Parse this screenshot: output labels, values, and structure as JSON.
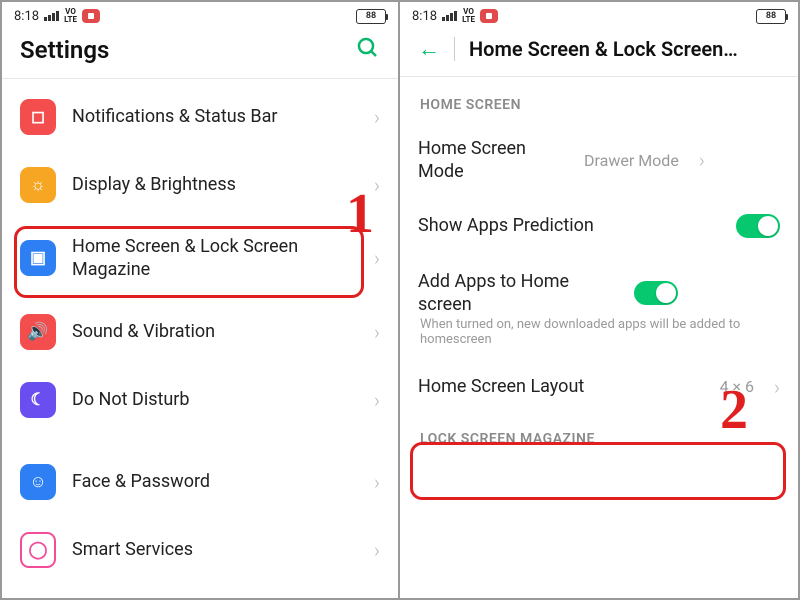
{
  "status": {
    "time": "8:18",
    "volte_top": "VO",
    "volte_bot": "LTE",
    "battery": "88"
  },
  "left": {
    "title": "Settings",
    "items": [
      {
        "label": "Notifications & Status Bar"
      },
      {
        "label": "Display & Brightness"
      },
      {
        "label": "Home Screen & Lock Screen Magazine"
      },
      {
        "label": "Sound & Vibration"
      },
      {
        "label": "Do Not Disturb"
      },
      {
        "label": "Face & Password"
      },
      {
        "label": "Smart Services"
      }
    ]
  },
  "right": {
    "title": "Home Screen & Lock Screen…",
    "section1": "HOME SCREEN",
    "mode_label": "Home Screen Mode",
    "mode_value": "Drawer Mode",
    "prediction_label": "Show Apps Prediction",
    "addapps_label": "Add Apps to Home screen",
    "addapps_sub": "When turned on, new downloaded apps will be added to homescreen",
    "layout_label": "Home Screen Layout",
    "layout_value": "4 × 6",
    "section2": "LOCK SCREEN MAGAZINE"
  },
  "steps": {
    "one": "1",
    "two": "2"
  }
}
